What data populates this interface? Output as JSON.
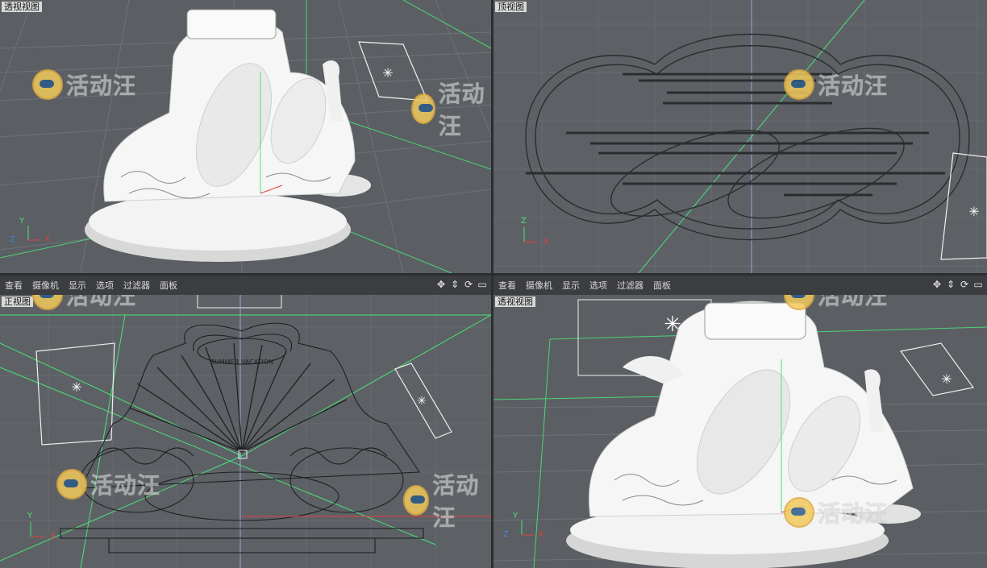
{
  "viewports": {
    "top_left": {
      "label": "透视视图"
    },
    "top_right": {
      "label": "顶视图"
    },
    "bottom_left": {
      "label": "正视图"
    },
    "bottom_right": {
      "label": "透视视图"
    }
  },
  "menu": [
    "查看",
    "摄像机",
    "显示",
    "选项",
    "过滤器",
    "面板"
  ],
  "watermark": "活动汪",
  "model_text": "SUMMER VACATION",
  "axes": {
    "x": "X",
    "y": "Y",
    "z": "Z"
  },
  "colors": {
    "viewport_bg": "#5b5f63",
    "grid": "#6b6f73",
    "green_line": "#3fcf6e",
    "model": "#efefef",
    "menubar": "#3b3d40"
  }
}
